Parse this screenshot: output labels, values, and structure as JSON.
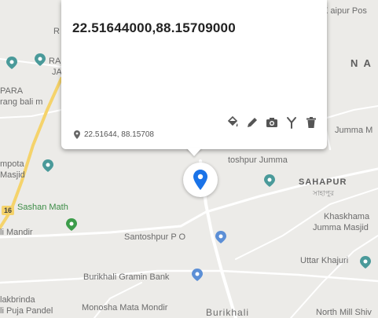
{
  "popup": {
    "title": "22.51644000,88.15709000",
    "coords_short": "22.51644, 88.15708"
  },
  "map_labels": {
    "r": "R",
    "ra": "RA",
    "ja": "JA",
    "para": "PARA",
    "rang_bali_m": "rang bali m",
    "mpota": "mpota",
    "masjid": "Masjid",
    "sashan_math": "Sashan Math",
    "li_mandir": "li Mandir",
    "santoshpur_po": "Santoshpur P O",
    "burikhali_gramin_bank": "Burikhali Gramin Bank",
    "lakbrinda": "lakbrinda",
    "li_puja_pandel": "li Puja Pandel",
    "monosha_mata_mondir": "Monosha Mata Mondir",
    "burikhali": "Burikhali",
    "north_mill_shiv": "North Mill Shiv",
    "uttar_khajuri": "Uttar Khajuri",
    "khaskhama": "Khaskhama",
    "jumma_masjid": "Jumma Masjid",
    "sahapur": "SAHAPUR",
    "sahapur_bengali": "সাহাপুর",
    "toshpur_jumma": "toshpur Jumma",
    "jumma_m": "Jumma M",
    "na": "N A",
    "x_aipur_pos": "X aipur Pos",
    "road_16": "16"
  },
  "colors": {
    "land": "#ecebe8",
    "road": "#ffffff",
    "highway": "#f5d36b",
    "marker": "#1a73e8",
    "poi_blue": "#5c8fd6",
    "poi_teal": "#4a9a9a",
    "poi_green": "#3c9c4a"
  },
  "icons": [
    "fill-bucket-icon",
    "pencil-icon",
    "camera-icon",
    "branch-icon",
    "trash-icon",
    "location-pin-icon"
  ]
}
